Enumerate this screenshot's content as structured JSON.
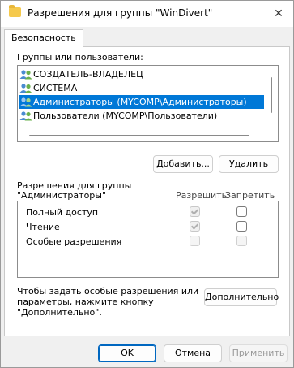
{
  "window": {
    "title": "Разрешения для группы \"WinDivert\"",
    "close_glyph": "✕"
  },
  "tabs": [
    {
      "label": "Безопасность",
      "active": true
    }
  ],
  "groups": {
    "label": "Группы или пользователи:",
    "items": [
      {
        "label": "СОЗДАТЕЛЬ-ВЛАДЕЛЕЦ",
        "icon": "user-group-icon",
        "selected": false
      },
      {
        "label": "СИСТЕМА",
        "icon": "user-group-icon",
        "selected": false
      },
      {
        "label": "Администраторы (MYCOMP\\Администраторы)",
        "icon": "user-group-icon",
        "selected": true
      },
      {
        "label": "Пользователи (MYCOMP\\Пользователи)",
        "icon": "user-group-icon",
        "selected": false
      }
    ]
  },
  "buttons": {
    "add": "Добавить...",
    "remove": "Удалить",
    "advanced": "Дополнительно",
    "ok": "OK",
    "cancel": "Отмена",
    "apply": "Применить"
  },
  "permissions": {
    "label_line1": "Разрешения для группы",
    "label_line2": "\"Администраторы\"",
    "allow_header": "Разрешить",
    "deny_header": "Запретить",
    "rows": [
      {
        "name": "Полный доступ",
        "allow": "checked-disabled",
        "deny": "unchecked"
      },
      {
        "name": "Чтение",
        "allow": "checked-disabled",
        "deny": "unchecked"
      },
      {
        "name": "Особые разрешения",
        "allow": "unchecked-disabled",
        "deny": "unchecked-disabled"
      }
    ]
  },
  "hint": {
    "line1": "Чтобы задать особые разрешения или",
    "line2": "параметры, нажмите кнопку",
    "line3": "\"Дополнительно\"."
  },
  "colors": {
    "selection": "#0078d7",
    "default_button_border": "#0067c0",
    "folder_icon": "#f5c94c"
  }
}
